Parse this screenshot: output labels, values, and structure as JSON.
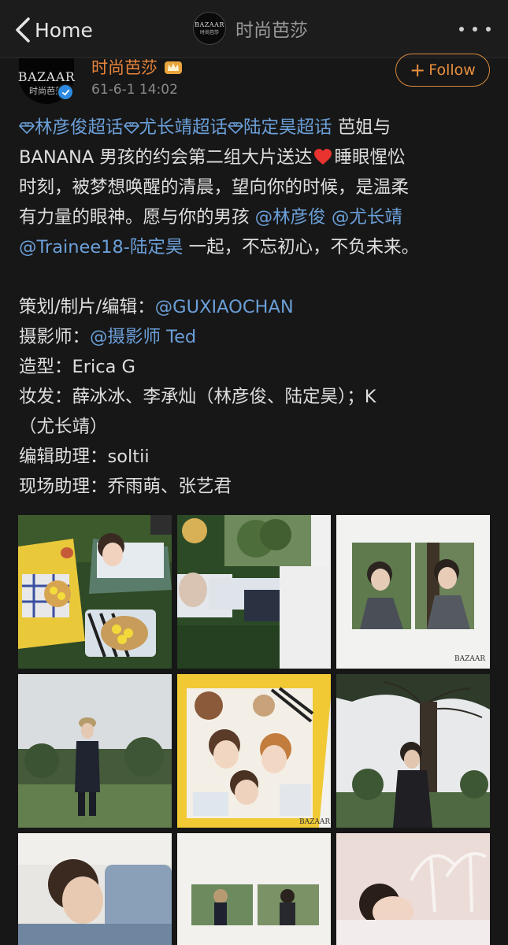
{
  "nav": {
    "back_label": "Home",
    "title": "时尚芭莎",
    "logo_word": "BAZAAR",
    "logo_sub": "时尚芭莎"
  },
  "post": {
    "user_name": "时尚芭莎",
    "time": "61-6-1 14:02",
    "follow_label": "Follow",
    "avatar_word": "BAZAAR",
    "avatar_sub": "时尚芭莎"
  },
  "body": {
    "topic_1": "林彦俊超话",
    "topic_2": "尤长靖超话",
    "topic_3": "陆定昊超话",
    "text_1": " 芭姐与",
    "text_2": "BANANA 男孩的约会第二组大片送达",
    "text_3": "睡眼惺忪",
    "text_4": "时刻，被梦想唤醒的清晨，望向你的时候，是温柔",
    "text_5": "有力量的眼神。愿与你的男孩 ",
    "mention_1": "@林彦俊",
    "mention_2": "@尤长靖",
    "mention_3": "@Trainee18-陆定昊",
    "text_6": " 一起，不忘初心，不负未来。",
    "credit_planning_label": "策划/制片/编辑：",
    "credit_planning_value": "@GUXIAOCHAN",
    "credit_photo_label": "摄影师：",
    "credit_photo_value": "@摄影师 Ted",
    "credit_style_label": "造型：",
    "credit_style_value": "Erica G",
    "credit_makeup_label": "妆发：",
    "credit_makeup_value_1": "薛冰冰、李承灿（林彦俊、陆定昊）；K",
    "credit_makeup_value_2": "（尤长靖）",
    "credit_editor_label": "编辑助理：",
    "credit_editor_value": "soltii",
    "credit_site_label": "现场助理：",
    "credit_site_value": "乔雨萌、张艺君"
  },
  "images": {
    "watermark": "BAZAAR"
  },
  "colors": {
    "background": "#171717",
    "accent_orange": "#e8843c",
    "link_blue": "#6b9fd8",
    "verified_blue": "#2c8be0"
  }
}
